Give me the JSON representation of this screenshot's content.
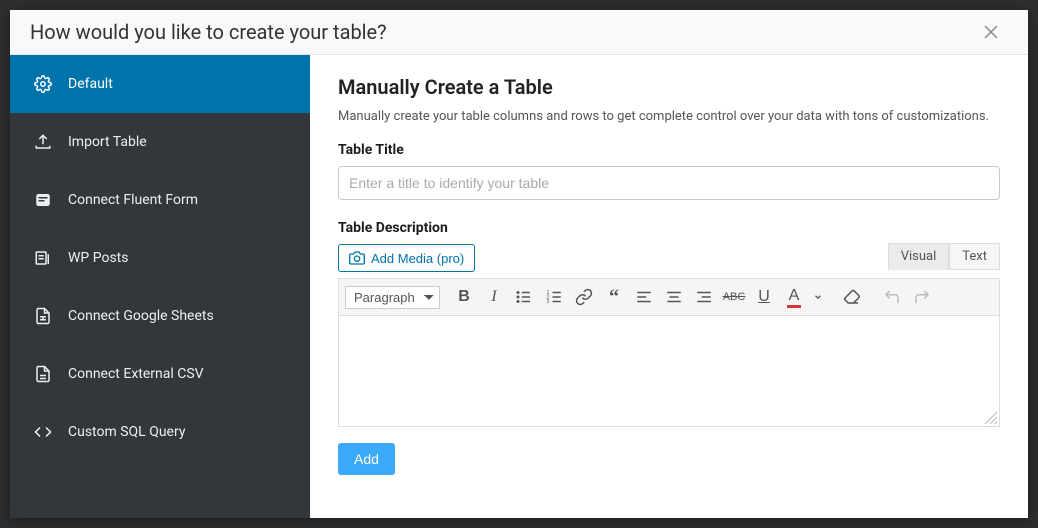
{
  "header": {
    "title": "How would you like to create your table?"
  },
  "sidebar": {
    "items": [
      {
        "label": "Default"
      },
      {
        "label": "Import Table"
      },
      {
        "label": "Connect Fluent Form"
      },
      {
        "label": "WP Posts"
      },
      {
        "label": "Connect Google Sheets"
      },
      {
        "label": "Connect External CSV"
      },
      {
        "label": "Custom SQL Query"
      }
    ]
  },
  "content": {
    "title": "Manually Create a Table",
    "description": "Manually create your table columns and rows to get complete control over your data with tons of customizations.",
    "title_label": "Table Title",
    "title_placeholder": "Enter a title to identify your table",
    "desc_label": "Table Description",
    "add_media_label": "Add Media (pro)",
    "tabs": {
      "visual": "Visual",
      "text": "Text"
    },
    "format_select": "Paragraph",
    "add_button": "Add"
  }
}
